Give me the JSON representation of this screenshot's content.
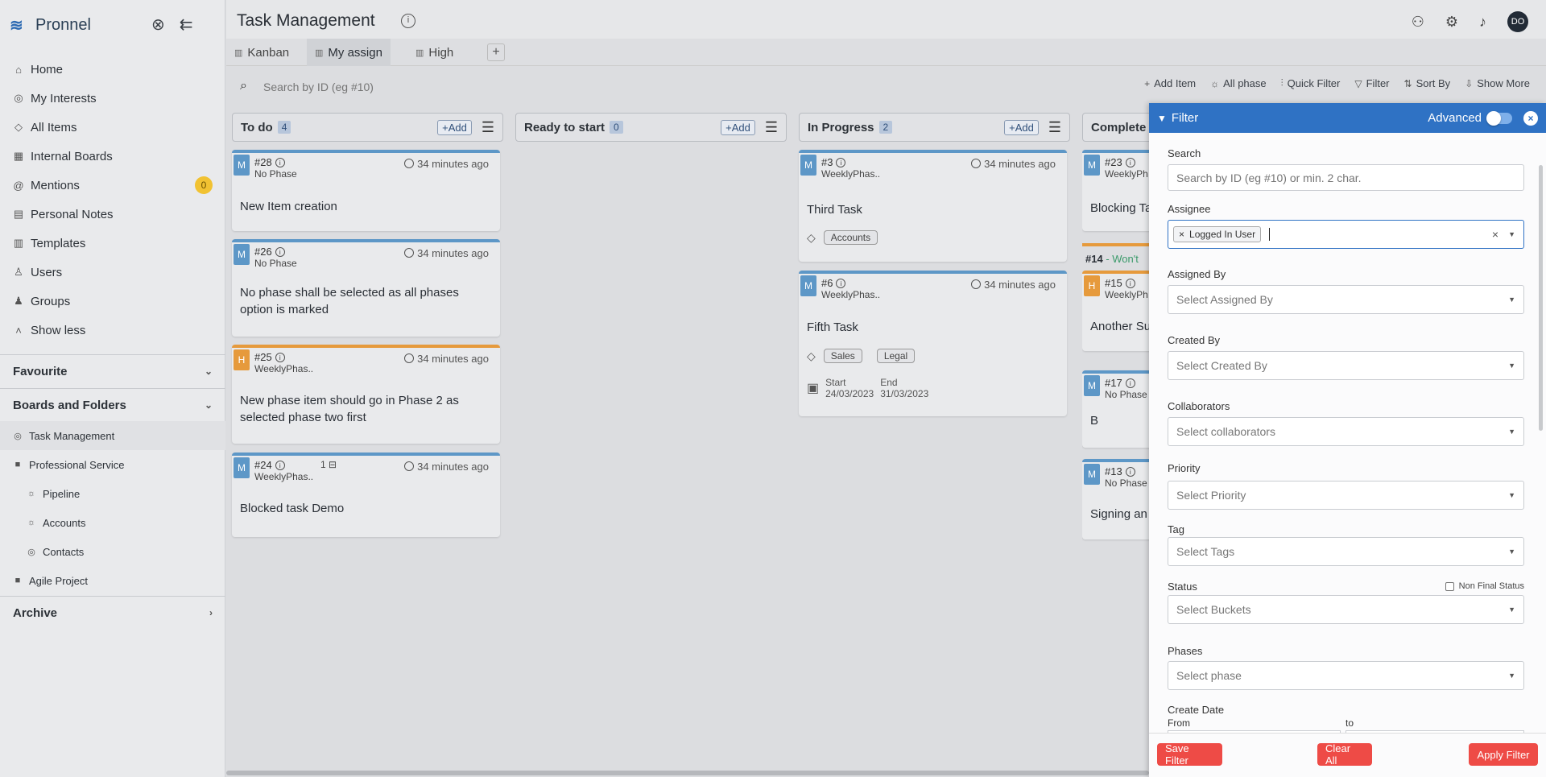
{
  "brand": {
    "name": "Pronnel"
  },
  "sidebar": {
    "nav": [
      {
        "label": "Home",
        "icon": "home-icon"
      },
      {
        "label": "My Interests",
        "icon": "target-icon"
      },
      {
        "label": "All Items",
        "icon": "tag-icon"
      },
      {
        "label": "Internal Boards",
        "icon": "board-icon"
      },
      {
        "label": "Mentions",
        "icon": "at-icon",
        "badge": "0"
      },
      {
        "label": "Personal Notes",
        "icon": "notes-icon"
      },
      {
        "label": "Templates",
        "icon": "template-icon"
      },
      {
        "label": "Users",
        "icon": "user-icon"
      },
      {
        "label": "Groups",
        "icon": "groups-icon"
      },
      {
        "label": "Show less",
        "icon": "chevron-up-icon"
      }
    ],
    "favourite": "Favourite",
    "boards_and_folders": "Boards and Folders",
    "tree": [
      {
        "label": "Task Management",
        "icon": "target-icon",
        "active": true
      },
      {
        "label": "Professional Service",
        "icon": "folder-icon"
      },
      {
        "label": "Pipeline",
        "icon": "bulb-icon"
      },
      {
        "label": "Accounts",
        "icon": "bulb-icon"
      },
      {
        "label": "Contacts",
        "icon": "target-icon"
      },
      {
        "label": "Agile Project",
        "icon": "folder-icon"
      }
    ],
    "archive": "Archive"
  },
  "header": {
    "title": "Task Management",
    "avatar": "DO"
  },
  "tabs": [
    {
      "label": "Kanban"
    },
    {
      "label": "My assign",
      "active": true
    },
    {
      "label": "High"
    }
  ],
  "toolbar": {
    "search_placeholder": "Search by ID (eg #10)",
    "add_item": "Add Item",
    "all_phase": "All phase",
    "quick_filter": "Quick Filter",
    "filter": "Filter",
    "sort_by": "Sort By",
    "show_more": "Show More"
  },
  "board": {
    "add_label": "+Add",
    "columns": [
      {
        "title": "To do",
        "count": "4",
        "cards": [
          {
            "pill": "M",
            "id": "#28",
            "phase": "No Phase",
            "time": "34 minutes ago",
            "title": "New Item creation"
          },
          {
            "pill": "M",
            "id": "#26",
            "phase": "No Phase",
            "time": "34 minutes ago",
            "title": "No phase shall be selected as all phases option is marked"
          },
          {
            "pill": "H",
            "id": "#25",
            "phase": "WeeklyPhas..",
            "time": "34 minutes ago",
            "title": "New phase item should go in Phase 2 as selected phase two first"
          },
          {
            "pill": "M",
            "id": "#24",
            "phase": "WeeklyPhas..",
            "time": "34 minutes ago",
            "title": "Blocked task Demo",
            "subtasks": "1"
          }
        ]
      },
      {
        "title": "Ready to start",
        "count": "0",
        "cards": []
      },
      {
        "title": "In Progress",
        "count": "2",
        "cards": [
          {
            "pill": "M",
            "id": "#3",
            "phase": "WeeklyPhas..",
            "time": "34 minutes ago",
            "title": "Third Task",
            "tags": [
              "Accounts"
            ]
          },
          {
            "pill": "M",
            "id": "#6",
            "phase": "WeeklyPhas..",
            "time": "34 minutes ago",
            "title": "Fifth Task",
            "tags": [
              "Sales",
              "Legal"
            ],
            "start_label": "Start",
            "start": "24/03/2023",
            "end_label": "End",
            "end": "31/03/2023"
          }
        ]
      },
      {
        "title": "Complete",
        "cards": [
          {
            "pill": "M",
            "id": "#23",
            "phase": "WeeklyPh",
            "title": "Blocking Ta"
          },
          {
            "group_id": "#14",
            "group_label": "- Won't"
          },
          {
            "pill": "H",
            "id": "#15",
            "phase": "WeeklyPh",
            "title": "Another Su"
          },
          {
            "pill": "M",
            "id": "#17",
            "phase": "No Phase",
            "title": "B"
          },
          {
            "pill": "M",
            "id": "#13",
            "phase": "No Phase",
            "title": "Signing an"
          }
        ]
      }
    ]
  },
  "filter_panel": {
    "title": "Filter",
    "advanced_label": "Advanced",
    "search_label": "Search",
    "search_placeholder": "Search by ID (eg #10) or min. 2 char.",
    "assignee_label": "Assignee",
    "assignee_chip": "Logged In User",
    "assigned_by_label": "Assigned By",
    "assigned_by_placeholder": "Select Assigned By",
    "created_by_label": "Created By",
    "created_by_placeholder": "Select Created By",
    "collaborators_label": "Collaborators",
    "collaborators_placeholder": "Select collaborators",
    "priority_label": "Priority",
    "priority_placeholder": "Select Priority",
    "tag_label": "Tag",
    "tag_placeholder": "Select Tags",
    "status_label": "Status",
    "non_final_status": "Non Final Status",
    "status_placeholder": "Select Buckets",
    "phases_label": "Phases",
    "phases_placeholder": "Select phase",
    "create_date_label": "Create Date",
    "from_label": "From",
    "to_label": "to",
    "save_filter": "Save Filter",
    "clear_all": "Clear All",
    "apply_filter": "Apply Filter"
  }
}
